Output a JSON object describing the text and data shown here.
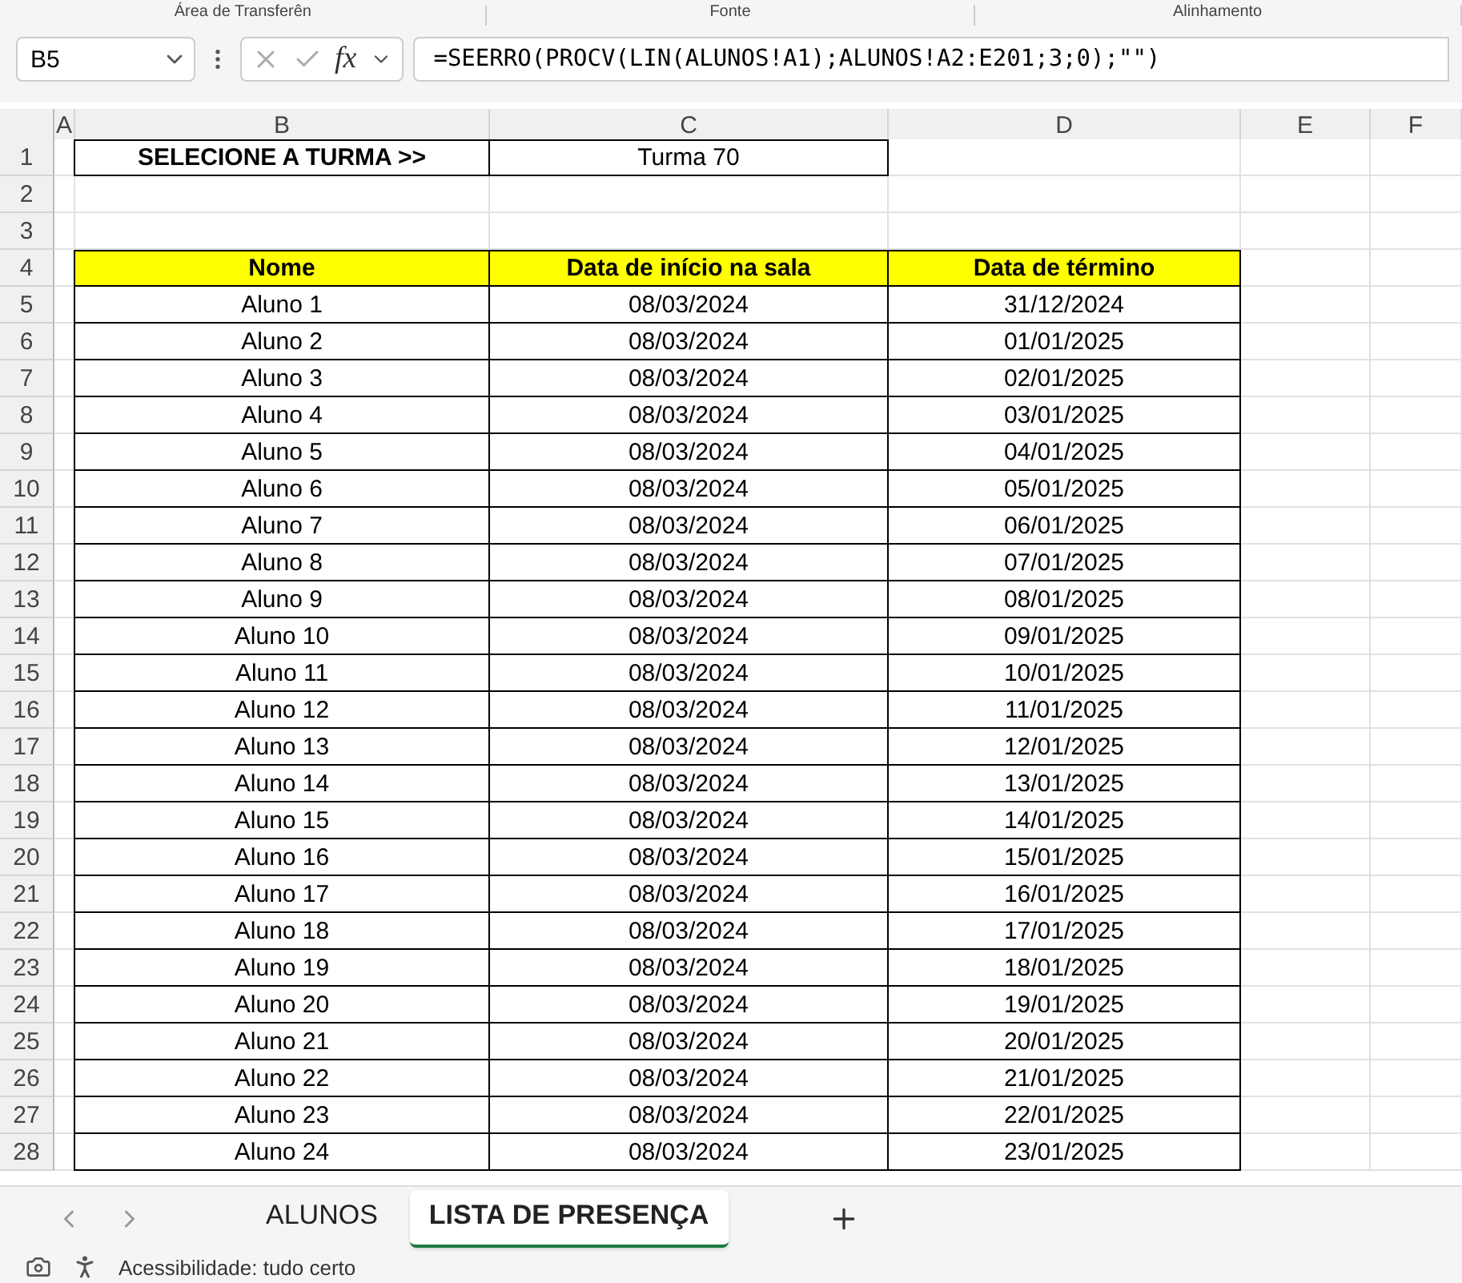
{
  "ribbon_groups": [
    "Área de Transferên",
    "Fonte",
    "Alinhamento"
  ],
  "name_box": "B5",
  "fx_label": "fx",
  "formula": "=SEERRO(PROCV(LIN(ALUNOS!A1);ALUNOS!A2:E201;3;0);\"\")",
  "columns": [
    "A",
    "B",
    "C",
    "D",
    "E",
    "F"
  ],
  "row_numbers": [
    "1",
    "2",
    "3",
    "4",
    "5",
    "6",
    "7",
    "8",
    "9",
    "10",
    "11",
    "12",
    "13",
    "14",
    "15",
    "16",
    "17",
    "18",
    "19",
    "20",
    "21",
    "22",
    "23",
    "24",
    "25",
    "26",
    "27",
    "28"
  ],
  "selector": {
    "label": "SELECIONE A TURMA >>",
    "value": "Turma 70"
  },
  "table": {
    "columns": [
      "Nome",
      "Data de início na sala",
      "Data de término"
    ],
    "rows": [
      [
        "Aluno 1",
        "08/03/2024",
        "31/12/2024"
      ],
      [
        "Aluno 2",
        "08/03/2024",
        "01/01/2025"
      ],
      [
        "Aluno 3",
        "08/03/2024",
        "02/01/2025"
      ],
      [
        "Aluno 4",
        "08/03/2024",
        "03/01/2025"
      ],
      [
        "Aluno 5",
        "08/03/2024",
        "04/01/2025"
      ],
      [
        "Aluno 6",
        "08/03/2024",
        "05/01/2025"
      ],
      [
        "Aluno 7",
        "08/03/2024",
        "06/01/2025"
      ],
      [
        "Aluno 8",
        "08/03/2024",
        "07/01/2025"
      ],
      [
        "Aluno 9",
        "08/03/2024",
        "08/01/2025"
      ],
      [
        "Aluno 10",
        "08/03/2024",
        "09/01/2025"
      ],
      [
        "Aluno 11",
        "08/03/2024",
        "10/01/2025"
      ],
      [
        "Aluno 12",
        "08/03/2024",
        "11/01/2025"
      ],
      [
        "Aluno 13",
        "08/03/2024",
        "12/01/2025"
      ],
      [
        "Aluno 14",
        "08/03/2024",
        "13/01/2025"
      ],
      [
        "Aluno 15",
        "08/03/2024",
        "14/01/2025"
      ],
      [
        "Aluno 16",
        "08/03/2024",
        "15/01/2025"
      ],
      [
        "Aluno 17",
        "08/03/2024",
        "16/01/2025"
      ],
      [
        "Aluno 18",
        "08/03/2024",
        "17/01/2025"
      ],
      [
        "Aluno 19",
        "08/03/2024",
        "18/01/2025"
      ],
      [
        "Aluno 20",
        "08/03/2024",
        "19/01/2025"
      ],
      [
        "Aluno 21",
        "08/03/2024",
        "20/01/2025"
      ],
      [
        "Aluno 22",
        "08/03/2024",
        "21/01/2025"
      ],
      [
        "Aluno 23",
        "08/03/2024",
        "22/01/2025"
      ],
      [
        "Aluno 24",
        "08/03/2024",
        "23/01/2025"
      ]
    ]
  },
  "sheet_tabs": [
    {
      "label": "ALUNOS",
      "selected": false
    },
    {
      "label": "LISTA DE PRESENÇA",
      "selected": true
    }
  ],
  "status": "Acessibilidade: tudo certo"
}
